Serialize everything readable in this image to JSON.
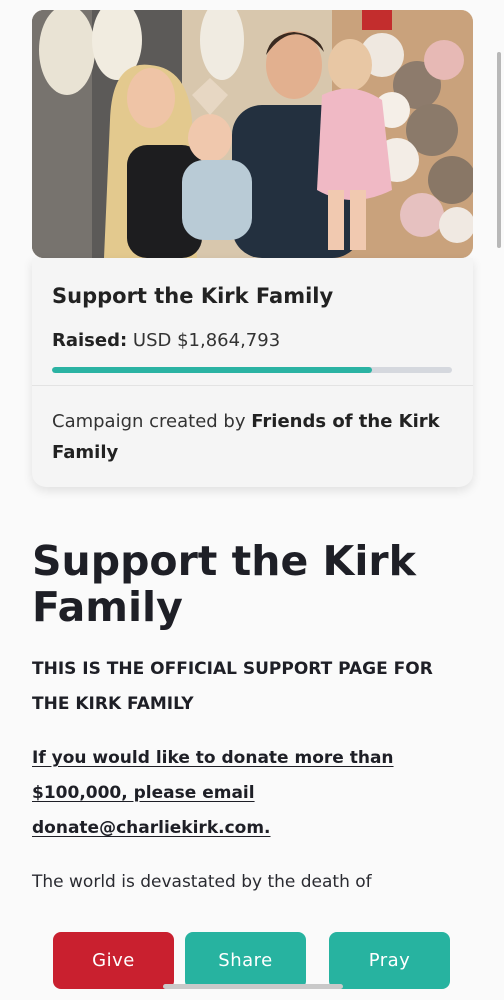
{
  "campaign": {
    "hero_image": "family-photo",
    "title": "Support the Kirk Family",
    "raised_label": "Raised:",
    "raised_amount": "USD $1,864,793",
    "progress_fraction": 0.8,
    "creator_prefix": "Campaign created by",
    "creator_name": "Friends of the Kirk Family"
  },
  "article": {
    "headline": "Support the Kirk Family",
    "official_notice": "THIS IS THE OFFICIAL SUPPORT PAGE FOR THE KIRK FAMILY",
    "donate_note": "If you would like to donate more than $100,000, please email donate@charliekirk.com.",
    "body_start": "The world is devastated by the death of"
  },
  "actions": {
    "give": "Give",
    "share": "Share",
    "pray": "Pray"
  },
  "colors": {
    "give": "#c9202f",
    "accent": "#27b3a0",
    "progress": "#2bb3a3"
  }
}
